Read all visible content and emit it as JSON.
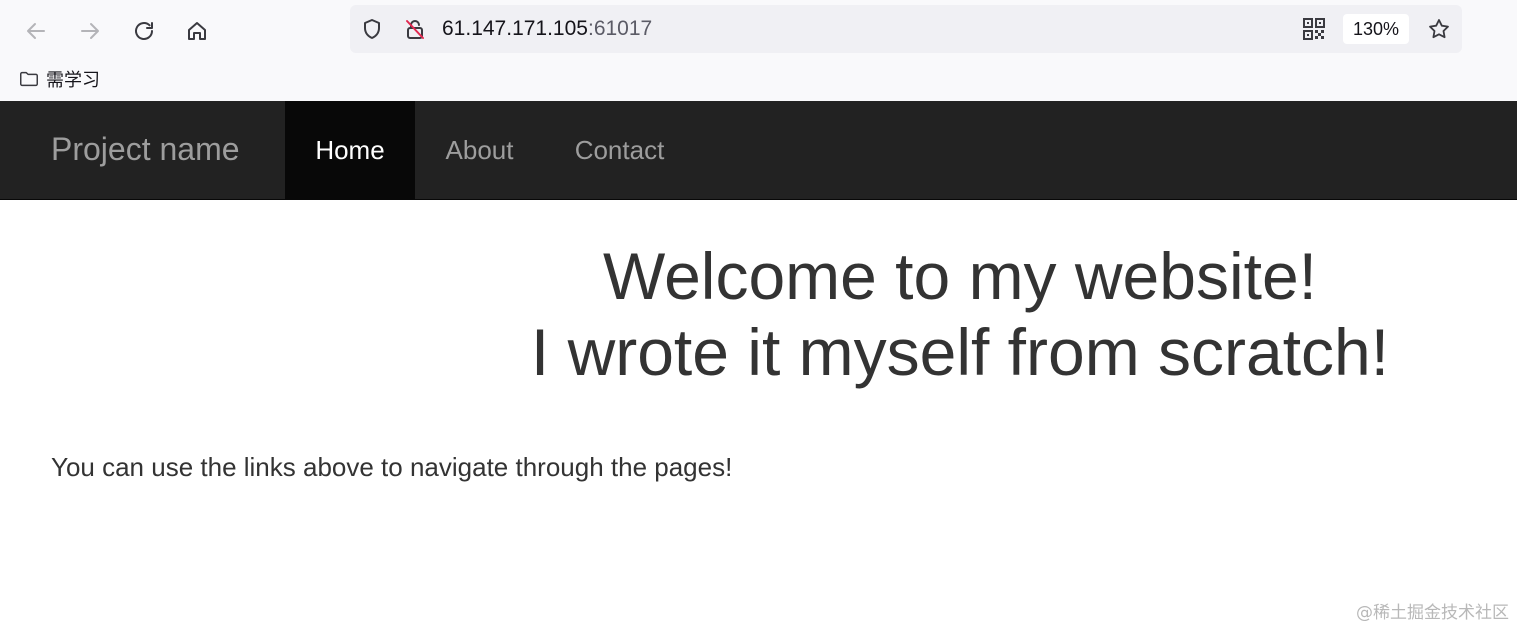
{
  "browser": {
    "url_host": "61.147.171.105",
    "url_port": ":61017",
    "zoom": "130%",
    "icons": [
      "back-icon",
      "forward-icon",
      "reload-icon",
      "home-icon",
      "shield-icon",
      "insecure-lock-icon",
      "qr-code-icon",
      "bookmark-star-icon",
      "folder-icon"
    ],
    "bookmarks": [
      {
        "label": "需学习"
      }
    ]
  },
  "site": {
    "brand": "Project name",
    "nav": [
      {
        "label": "Home",
        "active": true
      },
      {
        "label": "About",
        "active": false
      },
      {
        "label": "Contact",
        "active": false
      }
    ],
    "hero_line1": "Welcome to my website!",
    "hero_line2": "I wrote it myself from scratch!",
    "lead": "You can use the links above to navigate through the pages!"
  },
  "watermark": "@稀土掘金技术社区",
  "colors": {
    "navbar_bg": "#222222",
    "nav_active_bg": "#080808",
    "nav_text": "#9d9d9d",
    "body_text": "#333333"
  }
}
